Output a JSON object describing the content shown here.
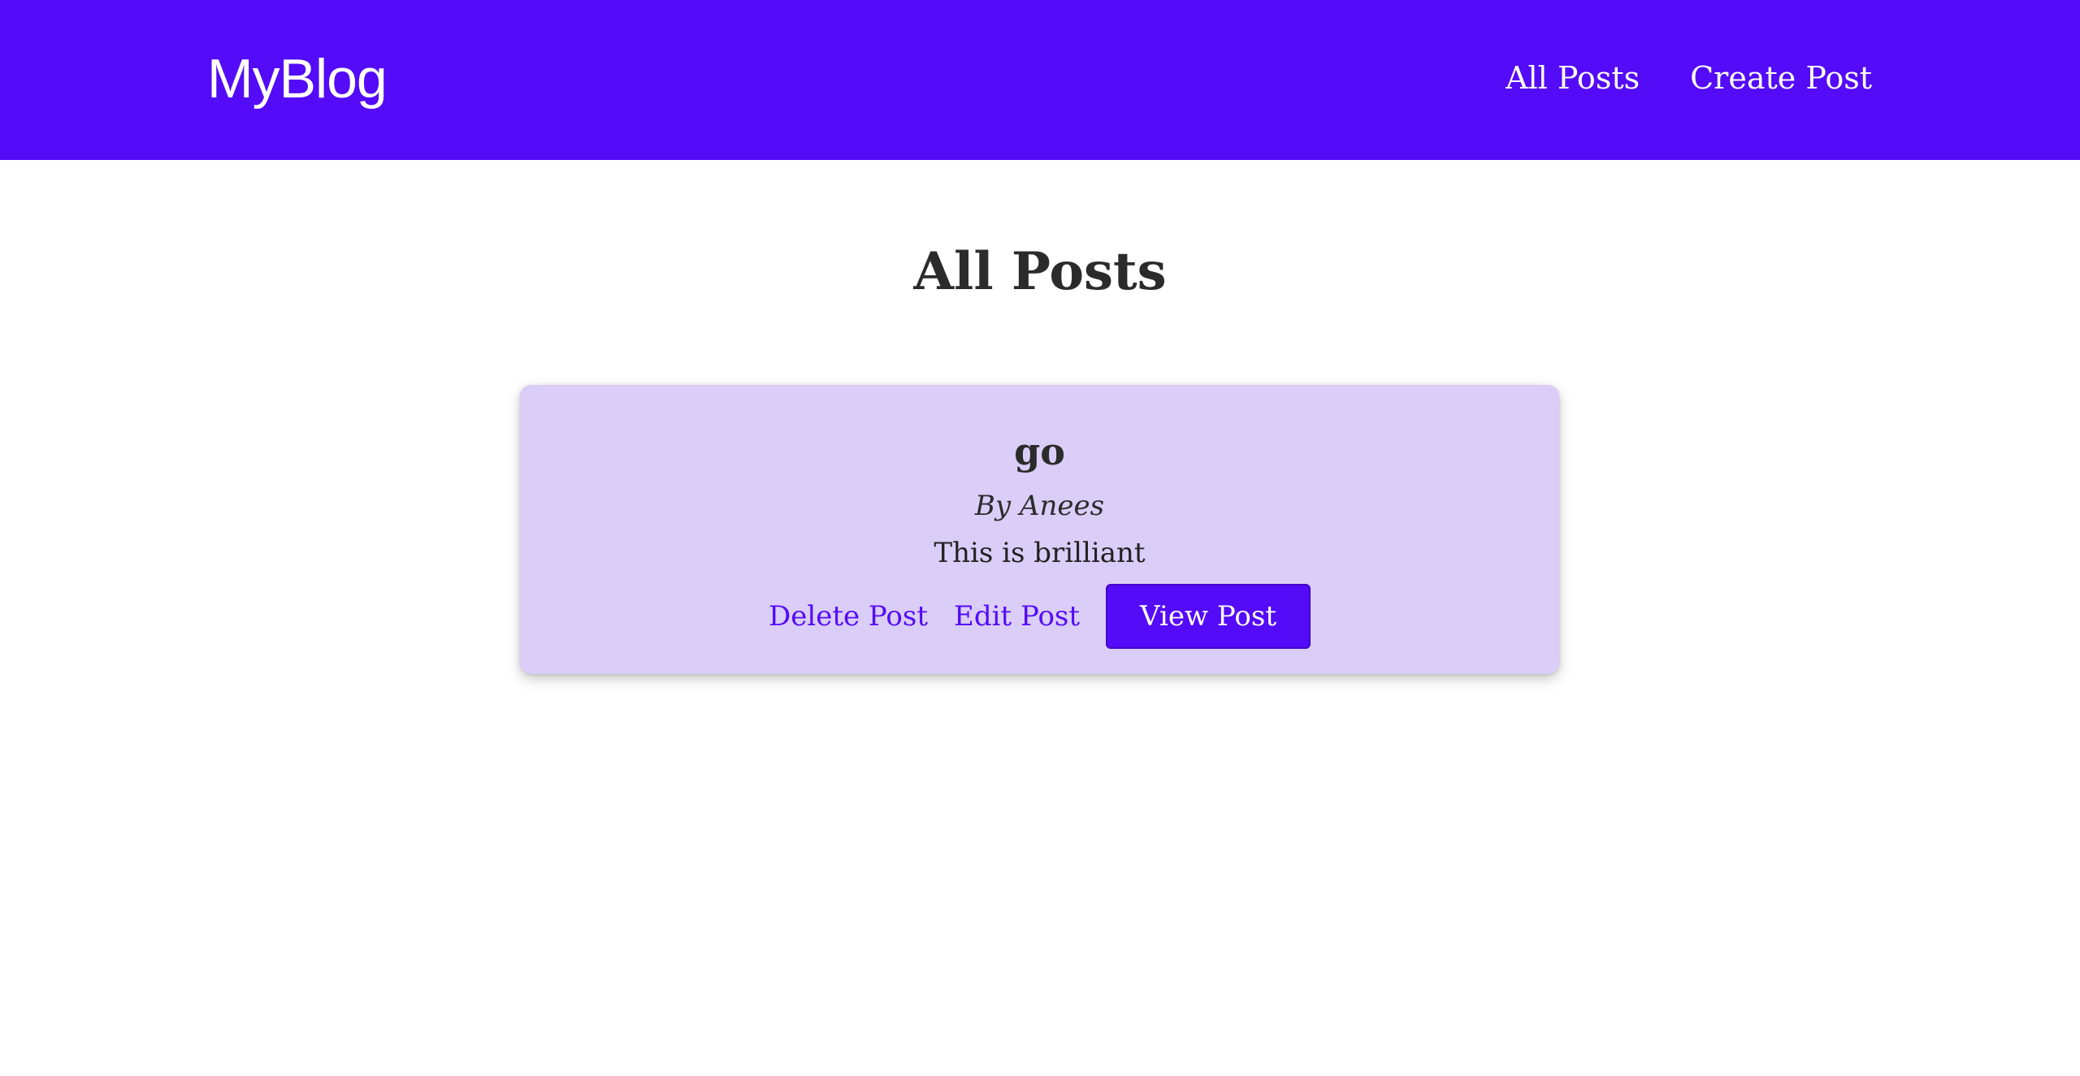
{
  "navbar": {
    "brand": "MyBlog",
    "links": [
      {
        "label": "All Posts"
      },
      {
        "label": "Create Post"
      }
    ]
  },
  "main": {
    "title": "All Posts",
    "posts": [
      {
        "title": "go",
        "author": "By Anees",
        "body": "This is brilliant",
        "delete_label": "Delete Post",
        "edit_label": "Edit Post",
        "view_label": "View Post"
      }
    ]
  },
  "colors": {
    "accent": "#540bf7",
    "card_background": "#dacdf7",
    "text": "#2b2b2b"
  }
}
